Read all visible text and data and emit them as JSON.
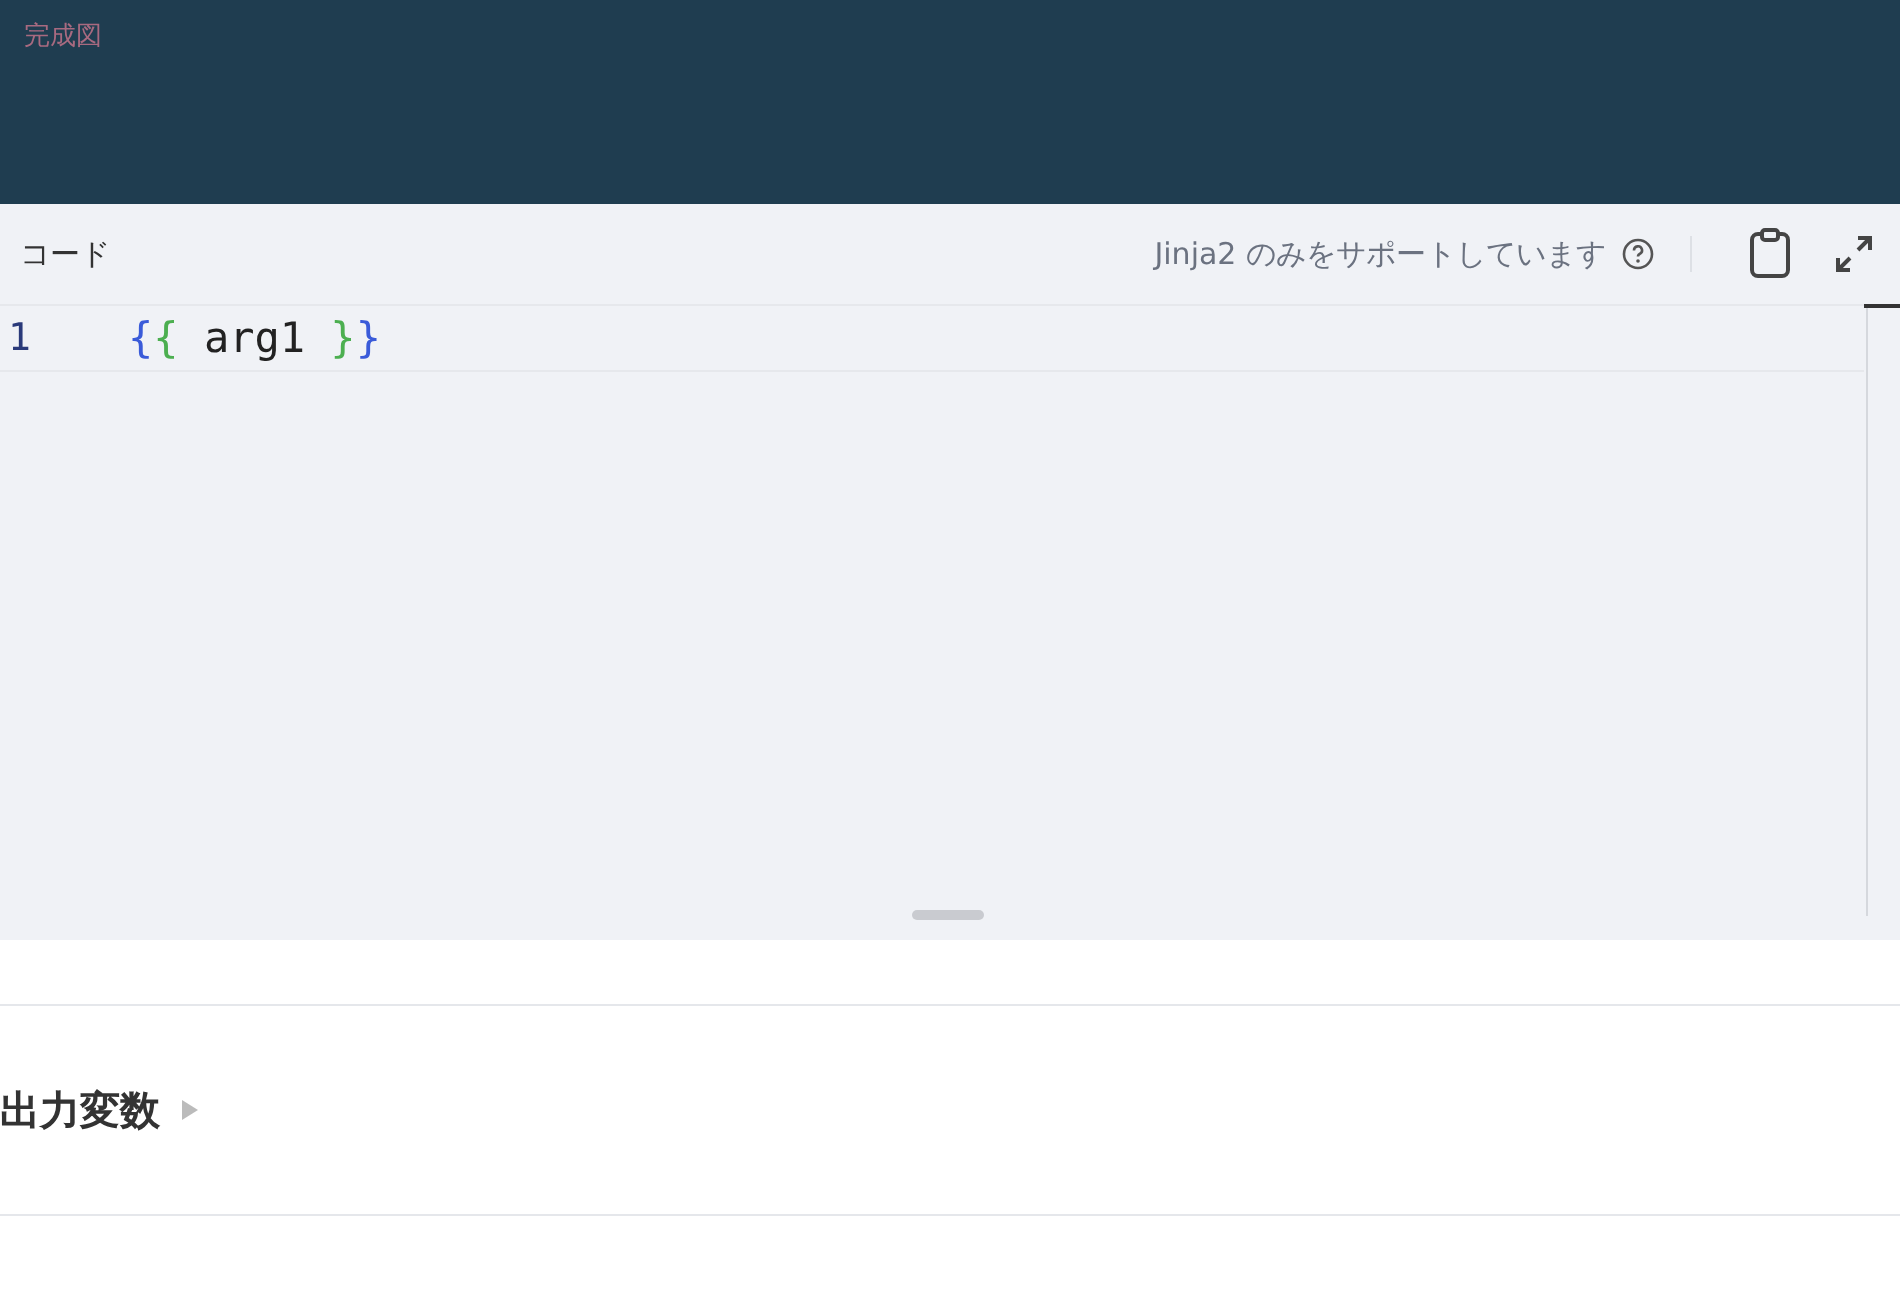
{
  "header": {
    "caption": "完成図"
  },
  "code_panel": {
    "title": "コード",
    "support_note": "Jinja2 のみをサポートしています",
    "lines": [
      {
        "number": "1",
        "tokens": [
          {
            "kind": "outer",
            "text": "{"
          },
          {
            "kind": "inner",
            "text": "{"
          },
          {
            "kind": "plain",
            "text": " arg1 "
          },
          {
            "kind": "inner",
            "text": "}"
          },
          {
            "kind": "outer",
            "text": "}"
          }
        ]
      }
    ]
  },
  "output_section": {
    "title": "出力変数",
    "expanded": false
  }
}
